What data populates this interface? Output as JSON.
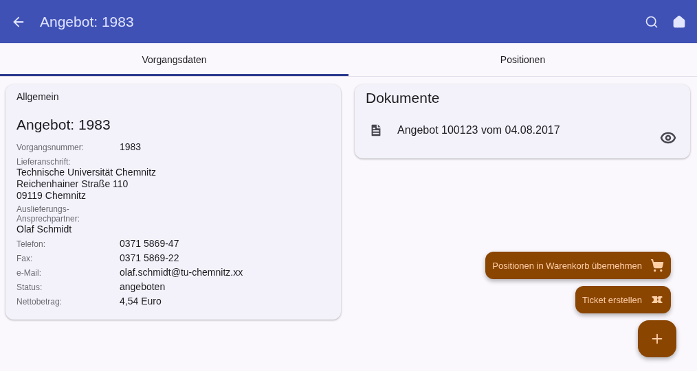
{
  "app_bar": {
    "title": "Angebot: 1983"
  },
  "tabs": [
    {
      "label": "Vorgangsdaten",
      "selected": true
    },
    {
      "label": "Positionen",
      "selected": false
    }
  ],
  "general_card": {
    "section": "Allgemein",
    "heading": "Angebot: 1983",
    "fields": [
      {
        "kind": "inline",
        "label": "Vorgangsnummer:",
        "value": "1983"
      },
      {
        "kind": "stacked",
        "label": "Lieferanschrift:",
        "lines": [
          "Technische Universität Chemnitz",
          "Reichenhainer Straße 110",
          "09119 Chemnitz"
        ]
      },
      {
        "kind": "stacked",
        "label": "Auslieferungs-\nAnsprechpartner:",
        "lines": [
          "Olaf Schmidt"
        ]
      },
      {
        "kind": "inline",
        "label": "Telefon:",
        "value": "0371 5869-47"
      },
      {
        "kind": "inline",
        "label": "Fax:",
        "value": "0371 5869-22"
      },
      {
        "kind": "inline",
        "label": "e-Mail:",
        "value": "olaf.schmidt@tu-chemnitz.xx"
      },
      {
        "kind": "inline",
        "label": "Status:",
        "value": "angeboten"
      },
      {
        "kind": "inline",
        "label": "Nettobetrag:",
        "value": "4,54 Euro"
      }
    ]
  },
  "documents_card": {
    "title": "Dokumente",
    "documents": [
      {
        "name": "Angebot 100123 vom 04.08.2017"
      }
    ]
  },
  "fab_actions": [
    {
      "kind": "cart",
      "label": "Positionen in Warenkorb übernehmen"
    },
    {
      "kind": "ticket",
      "label": "Ticket erstellen"
    }
  ]
}
